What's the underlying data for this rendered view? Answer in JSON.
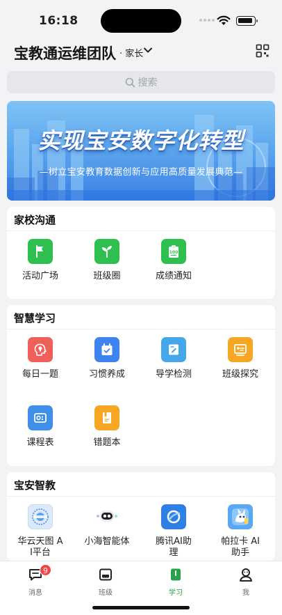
{
  "status_bar": {
    "time": "16:18"
  },
  "header": {
    "team_name": "宝教通运维团队",
    "role": "· 家长"
  },
  "search": {
    "placeholder": "搜索"
  },
  "banner": {
    "title": "实现宝安数字化转型",
    "subtitle": "—树立宝安教育数据创新与应用高质量发展典范—"
  },
  "sections": [
    {
      "title": "家校沟通",
      "items": [
        {
          "label": "活动广场",
          "icon": "flag-icon",
          "color": "#2fbf4e"
        },
        {
          "label": "班级圈",
          "icon": "sprout-icon",
          "color": "#2fbf4e"
        },
        {
          "label": "成绩通知",
          "icon": "score-report-icon",
          "color": "#2fbf4e"
        }
      ]
    },
    {
      "title": "智慧学习",
      "items": [
        {
          "label": "每日一题",
          "icon": "lightbulb-head-icon",
          "color": "#f0605a"
        },
        {
          "label": "习惯养成",
          "icon": "calendar-check-icon",
          "color": "#3f83f0"
        },
        {
          "label": "导学检测",
          "icon": "edit-doc-icon",
          "color": "#45a7e8"
        },
        {
          "label": "班级探究",
          "icon": "presentation-icon",
          "color": "#f5a623"
        },
        {
          "label": "课程表",
          "icon": "timetable-icon",
          "color": "#3f8fe8"
        },
        {
          "label": "错题本",
          "icon": "notebook-icon",
          "color": "#f5a623"
        }
      ]
    },
    {
      "title": "宝安智教",
      "items": [
        {
          "label": "华云天图 AI平台",
          "label_lines": [
            "华云天图 A",
            "I平台"
          ],
          "icon": "huayun-logo-icon",
          "color": "#dbe9fb"
        },
        {
          "label": "小海智能体",
          "label_lines": [
            "小海智能体"
          ],
          "icon": "robot-icon",
          "color": "#ffffff"
        },
        {
          "label": "腾讯AI助理",
          "label_lines": [
            "腾讯AI助",
            "理"
          ],
          "icon": "tencent-ai-icon",
          "color": "#2f7fe4"
        },
        {
          "label": "帕拉卡AI助手",
          "label_lines": [
            "帕拉卡 AI",
            "助手"
          ],
          "icon": "palaka-ai-icon",
          "color": "#5aa9f0"
        }
      ]
    }
  ],
  "tab_bar": {
    "tabs": [
      {
        "label": "消息",
        "icon": "message-icon",
        "badge": "9"
      },
      {
        "label": "班级",
        "icon": "class-icon"
      },
      {
        "label": "学习",
        "icon": "study-icon",
        "active": true
      },
      {
        "label": "我",
        "icon": "profile-icon"
      }
    ],
    "active_color": "#27a24a"
  }
}
